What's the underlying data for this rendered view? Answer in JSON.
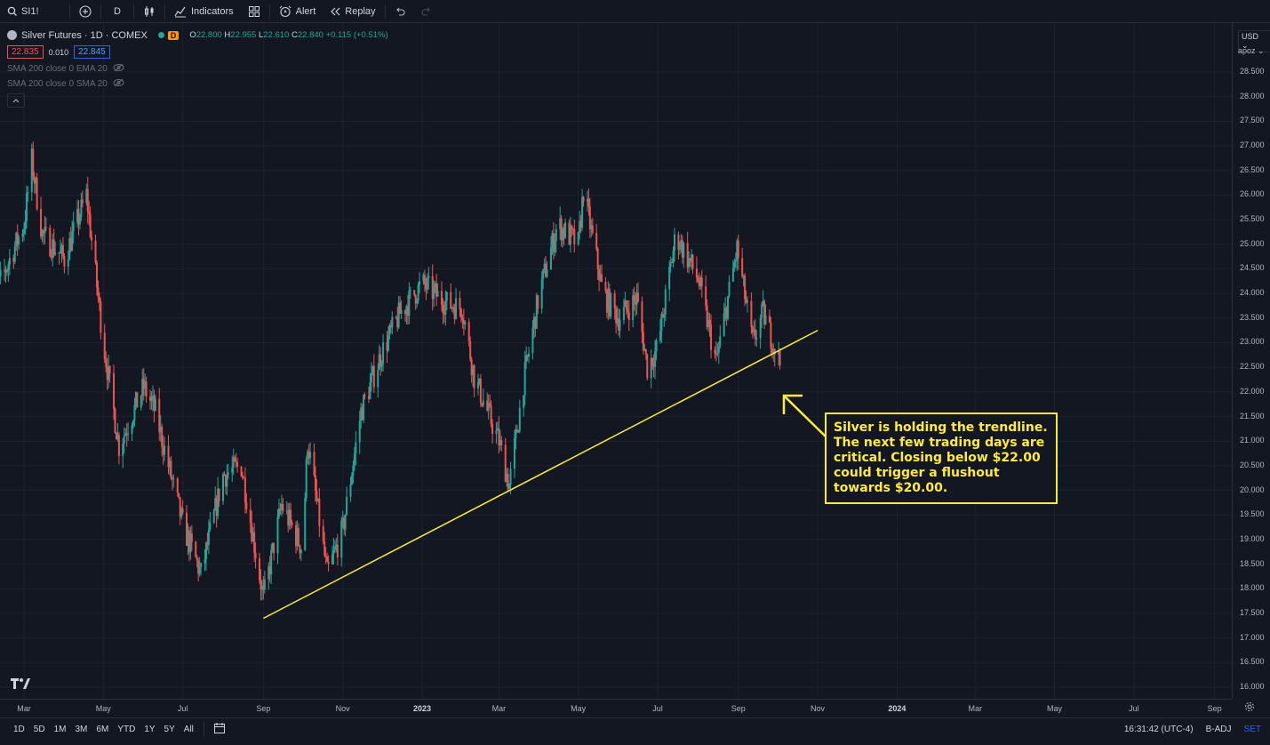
{
  "toolbar": {
    "symbol": "SI1!",
    "interval": "D",
    "indicators_label": "Indicators",
    "alert_label": "Alert",
    "replay_label": "Replay"
  },
  "legend": {
    "title": "Silver Futures · 1D · COMEX",
    "badge": "D",
    "open_key": "O",
    "open": "22.800",
    "high_key": "H",
    "high": "22.955",
    "low_key": "L",
    "low": "22.610",
    "close_key": "C",
    "close": "22.840",
    "change": "+0.115 (+0.51%)",
    "bid": "22.835",
    "spread": "0.010",
    "ask": "22.845",
    "indicator_1": "SMA 200 close 0 EMA 20",
    "indicator_2": "SMA 200 close 0 SMA 20"
  },
  "price_axis": {
    "currency": "USD",
    "mode": "apoz",
    "ticks": [
      "28.500",
      "28.000",
      "27.500",
      "27.000",
      "26.500",
      "26.000",
      "25.500",
      "25.000",
      "24.500",
      "24.000",
      "23.500",
      "23.000",
      "22.500",
      "22.000",
      "21.500",
      "21.000",
      "20.500",
      "20.000",
      "19.500",
      "19.000",
      "18.500",
      "18.000",
      "17.500",
      "17.000",
      "16.500",
      "16.000"
    ]
  },
  "time_axis": {
    "ticks": [
      "Mar",
      "May",
      "Jul",
      "Sep",
      "Nov",
      "2023",
      "Mar",
      "May",
      "Jul",
      "Sep",
      "Nov",
      "2024",
      "Mar",
      "May",
      "Jul",
      "Sep"
    ]
  },
  "bottom_bar": {
    "ranges": [
      "1D",
      "5D",
      "1M",
      "3M",
      "6M",
      "YTD",
      "1Y",
      "5Y",
      "All"
    ],
    "time": "16:31:42 (UTC-4)",
    "adjustment": "B-ADJ",
    "session": "SET"
  },
  "annotation": {
    "text": "Silver is holding the trendline. The next few trading days are critical. Closing below $22.00 could trigger a flushout towards $20.00."
  },
  "colors": {
    "background": "#131722",
    "up": "#26a69a",
    "down": "#ef5350",
    "trendline": "#ffeb3b"
  },
  "chart_data": {
    "type": "candlestick",
    "symbol": "Silver Futures",
    "ylim": [
      16.0,
      28.5
    ],
    "trendline": {
      "from": {
        "date": "2022-09-01",
        "price": 17.4
      },
      "to": {
        "date": "2023-11-01",
        "price": 23.25
      }
    },
    "path": [
      {
        "date": "2022-02-01",
        "price": 23.6
      },
      {
        "date": "2022-02-15",
        "price": 24.5
      },
      {
        "date": "2022-03-01",
        "price": 25.4
      },
      {
        "date": "2022-03-07",
        "price": 26.7
      },
      {
        "date": "2022-03-15",
        "price": 25.2
      },
      {
        "date": "2022-04-01",
        "price": 24.7
      },
      {
        "date": "2022-04-18",
        "price": 26.0
      },
      {
        "date": "2022-05-01",
        "price": 23.0
      },
      {
        "date": "2022-05-13",
        "price": 20.9
      },
      {
        "date": "2022-06-01",
        "price": 22.1
      },
      {
        "date": "2022-06-10",
        "price": 21.6
      },
      {
        "date": "2022-07-01",
        "price": 19.3
      },
      {
        "date": "2022-07-15",
        "price": 18.3
      },
      {
        "date": "2022-08-01",
        "price": 20.3
      },
      {
        "date": "2022-08-15",
        "price": 20.5
      },
      {
        "date": "2022-09-01",
        "price": 17.8
      },
      {
        "date": "2022-09-15",
        "price": 19.7
      },
      {
        "date": "2022-10-01",
        "price": 18.8
      },
      {
        "date": "2022-10-05",
        "price": 21.0
      },
      {
        "date": "2022-10-20",
        "price": 18.3
      },
      {
        "date": "2022-11-01",
        "price": 19.2
      },
      {
        "date": "2022-11-15",
        "price": 21.6
      },
      {
        "date": "2022-12-01",
        "price": 22.8
      },
      {
        "date": "2022-12-15",
        "price": 23.6
      },
      {
        "date": "2023-01-01",
        "price": 24.2
      },
      {
        "date": "2023-01-20",
        "price": 23.8
      },
      {
        "date": "2023-02-01",
        "price": 23.7
      },
      {
        "date": "2023-02-10",
        "price": 22.3
      },
      {
        "date": "2023-03-01",
        "price": 21.0
      },
      {
        "date": "2023-03-09",
        "price": 20.1
      },
      {
        "date": "2023-03-20",
        "price": 22.2
      },
      {
        "date": "2023-04-01",
        "price": 24.0
      },
      {
        "date": "2023-04-15",
        "price": 25.4
      },
      {
        "date": "2023-05-01",
        "price": 25.0
      },
      {
        "date": "2023-05-05",
        "price": 26.1
      },
      {
        "date": "2023-05-20",
        "price": 24.0
      },
      {
        "date": "2023-06-01",
        "price": 23.5
      },
      {
        "date": "2023-06-15",
        "price": 23.9
      },
      {
        "date": "2023-06-23",
        "price": 22.5
      },
      {
        "date": "2023-07-01",
        "price": 22.9
      },
      {
        "date": "2023-07-15",
        "price": 25.2
      },
      {
        "date": "2023-08-01",
        "price": 24.3
      },
      {
        "date": "2023-08-15",
        "price": 22.6
      },
      {
        "date": "2023-08-31",
        "price": 24.9
      },
      {
        "date": "2023-09-12",
        "price": 23.0
      },
      {
        "date": "2023-09-20",
        "price": 23.6
      },
      {
        "date": "2023-10-03",
        "price": 22.6
      }
    ]
  }
}
